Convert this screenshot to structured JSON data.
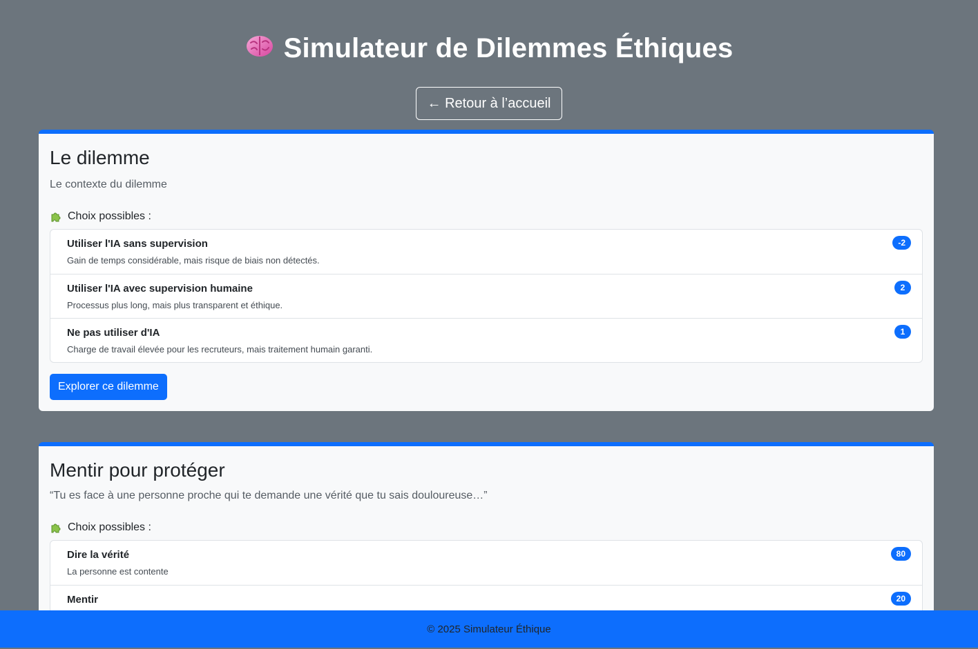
{
  "header": {
    "title": "Simulateur de Dilemmes Éthiques",
    "back_label": "← Retour à l’accueil"
  },
  "dilemmas": [
    {
      "title": "Le dilemme",
      "context": "Le contexte du dilemme",
      "choices_heading": "Choix possibles :",
      "choices": [
        {
          "label": "Utiliser l'IA sans supervision",
          "description": "Gain de temps considérable, mais risque de biais non détectés.",
          "score": "-2"
        },
        {
          "label": "Utiliser l'IA avec supervision humaine",
          "description": "Processus plus long, mais plus transparent et éthique.",
          "score": "2"
        },
        {
          "label": "Ne pas utiliser d'IA",
          "description": "Charge de travail élevée pour les recruteurs, mais traitement humain garanti.",
          "score": "1"
        }
      ],
      "explore_label": "Explorer ce dilemme"
    },
    {
      "title": "Mentir pour protéger",
      "context": "“Tu es face à une personne proche qui te demande une vérité que tu sais douloureuse…”",
      "choices_heading": "Choix possibles :",
      "choices": [
        {
          "label": "Dire la vérité",
          "description": "La personne est contente",
          "score": "80"
        },
        {
          "label": "Mentir",
          "description": "",
          "score": "20"
        }
      ]
    }
  ],
  "footer": {
    "text": "© 2025 Simulateur Éthique"
  },
  "icons": {
    "brain": "brain-icon",
    "puzzle": "puzzle-piece-icon"
  },
  "colors": {
    "background": "#6c757d",
    "accent": "#0d6efd",
    "card": "#f8f9fa"
  }
}
